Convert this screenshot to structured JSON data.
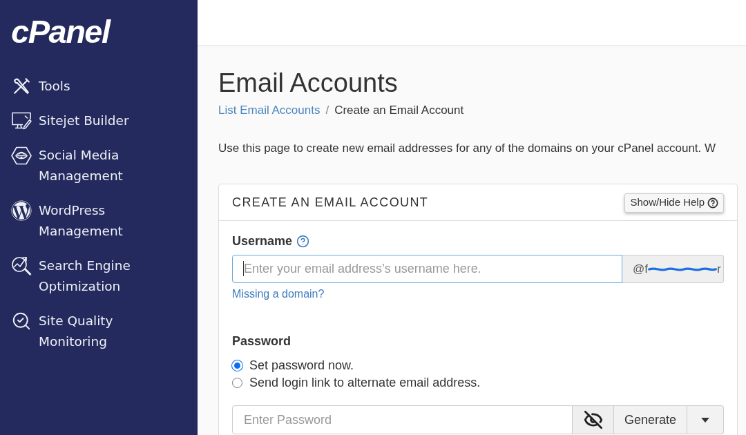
{
  "sidebar": {
    "logo": "cPanel",
    "items": [
      {
        "label": "Tools"
      },
      {
        "label": "Sitejet Builder"
      },
      {
        "label": "Social Media Management"
      },
      {
        "label": "WordPress Management"
      },
      {
        "label": "Search Engine Optimization"
      },
      {
        "label": "Site Quality Monitoring"
      }
    ]
  },
  "page": {
    "title": "Email Accounts",
    "breadcrumb": [
      {
        "label": "List Email Accounts",
        "kind": "link"
      },
      {
        "label": "Create an Email Account",
        "kind": "current"
      }
    ],
    "breadcrumb_separator": "/",
    "description": "Use this page to create new email addresses for any of the domains on your cPanel account. W"
  },
  "form": {
    "title": "CREATE AN EMAIL ACCOUNT",
    "help_button": "Show/Hide Help",
    "username": {
      "label": "Username",
      "placeholder": "Enter your email address’s username here.",
      "focused": true,
      "domain_start": "@f",
      "domain_end": "r",
      "link": "Missing a domain?"
    },
    "password": {
      "label": "Password",
      "options": [
        {
          "label": "Set password now.",
          "selected": true
        },
        {
          "label": "Send login link to alternate email address.",
          "selected": false
        }
      ],
      "placeholder": "Enter Password",
      "generate_button": "Generate"
    }
  }
}
